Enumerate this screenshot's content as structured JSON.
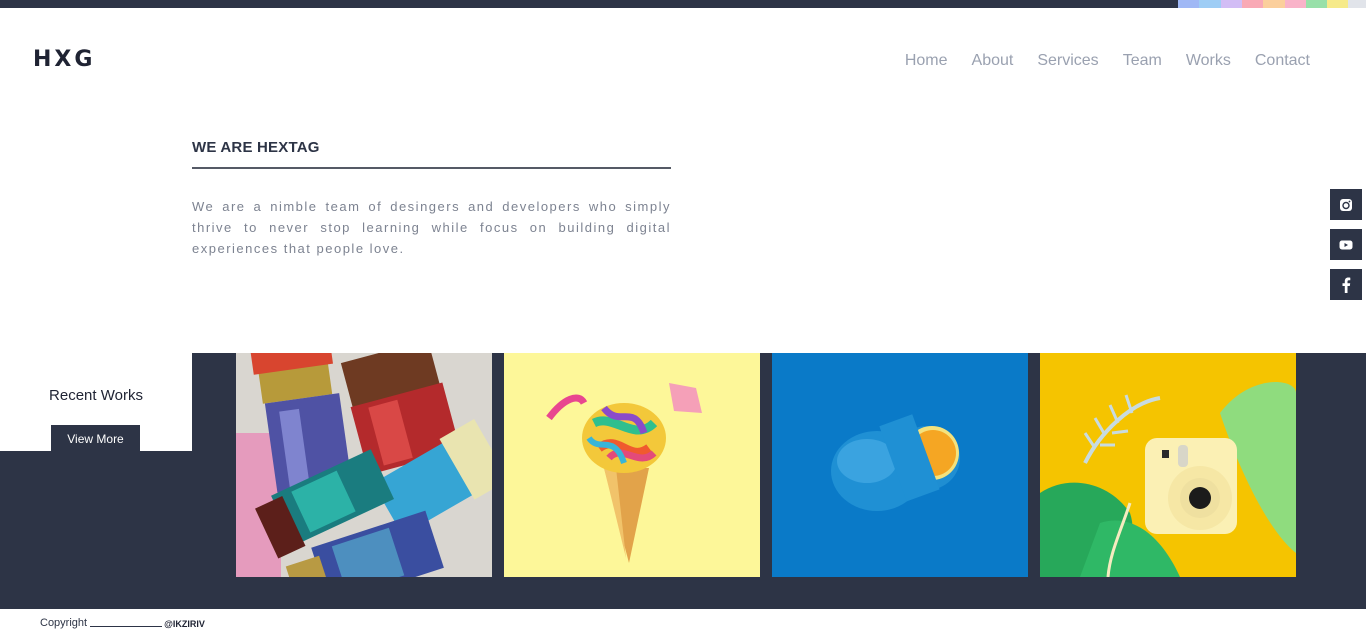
{
  "topbar": {
    "base_color": "#2d3446",
    "swatches": [
      "#a0b8f5",
      "#9ecdf5",
      "#d2bdf5",
      "#f9a9b5",
      "#fbcf9c",
      "#f9b3c9",
      "#98e0a9",
      "#f6ea8a",
      "#e1e4ea"
    ]
  },
  "header": {
    "logo": "HXG",
    "nav": [
      "Home",
      "About",
      "Services",
      "Team",
      "Works",
      "Contact"
    ]
  },
  "about": {
    "title": "WE ARE HEXTAG",
    "body": "We are a nimble team of desingers and developers who simply thrive to never stop learning while focus on building digital experiences that people love."
  },
  "social": [
    {
      "icon": "instagram-icon"
    },
    {
      "icon": "youtube-icon"
    },
    {
      "icon": "facebook-icon"
    }
  ],
  "recent_works": {
    "title": "Recent Works",
    "button": "View More",
    "items": [
      {
        "name": "paint-brushes",
        "description": "Colorful paint brushes"
      },
      {
        "name": "confetti-cone",
        "description": "Confetti in ice cream cone on yellow"
      },
      {
        "name": "blue-orange",
        "description": "Blue painted orange on blue"
      },
      {
        "name": "instant-camera",
        "description": "Instant camera with paper leaves on yellow"
      }
    ]
  },
  "footer": {
    "copyright": "Copyright",
    "handle": "@IKZIRIV"
  },
  "colors": {
    "dark": "#2d3446",
    "nav_text": "#9aa1b0",
    "body_text": "#7d8391"
  }
}
